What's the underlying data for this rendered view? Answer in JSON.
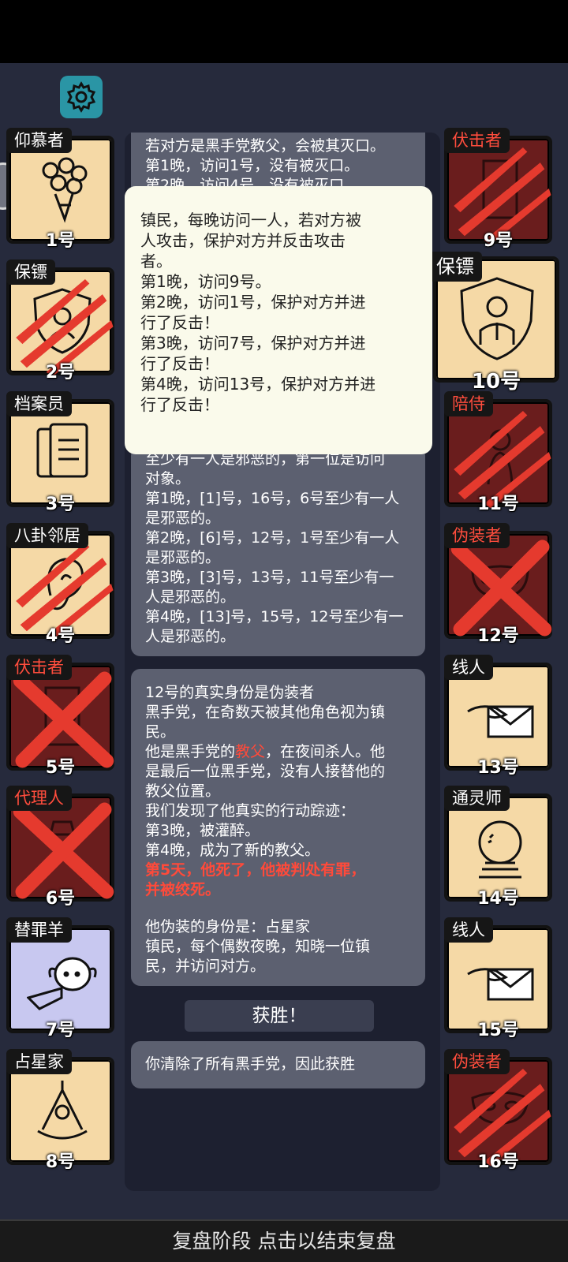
{
  "header": {
    "settings_icon": "gear-icon"
  },
  "players": [
    {
      "role": "仰慕者",
      "number": "1号",
      "state": "alive",
      "icon": "bouquet-icon",
      "role_red": false
    },
    {
      "role": "保镖",
      "number": "2号",
      "state": "alive",
      "icon": "shield-icon",
      "role_red": false,
      "clawed": true
    },
    {
      "role": "档案员",
      "number": "3号",
      "state": "alive",
      "icon": "documents-icon",
      "role_red": false
    },
    {
      "role": "八卦邻居",
      "number": "4号",
      "state": "alive",
      "icon": "ear-icon",
      "role_red": false,
      "clawed": true
    },
    {
      "role": "伏击者",
      "number": "5号",
      "state": "dead",
      "icon": "door-icon",
      "role_red": true,
      "crossed": true
    },
    {
      "role": "代理人",
      "number": "6号",
      "state": "dead",
      "icon": "agent-icon",
      "role_red": true,
      "crossed": true
    },
    {
      "role": "替罪羊",
      "number": "7号",
      "state": "goat",
      "icon": "scapegoat-icon",
      "role_red": false
    },
    {
      "role": "占星家",
      "number": "8号",
      "state": "alive",
      "icon": "sextant-icon",
      "role_red": false
    },
    {
      "role": "伏击者",
      "number": "9号",
      "state": "dead",
      "icon": "door-icon",
      "role_red": true,
      "clawed": true
    },
    {
      "role": "保镖",
      "number": "10号",
      "state": "alive",
      "icon": "bodyguard-shield-icon",
      "role_red": false,
      "selected": true
    },
    {
      "role": "陪侍",
      "number": "11号",
      "state": "dead",
      "icon": "escort-icon",
      "role_red": true,
      "clawed": true
    },
    {
      "role": "伪装者",
      "number": "12号",
      "state": "dead",
      "icon": "mask-icon",
      "role_red": true,
      "crossed": true
    },
    {
      "role": "线人",
      "number": "13号",
      "state": "alive",
      "icon": "envelope-hand-icon",
      "role_red": false
    },
    {
      "role": "通灵师",
      "number": "14号",
      "state": "alive",
      "icon": "crystal-ball-icon",
      "role_red": false
    },
    {
      "role": "线人",
      "number": "15号",
      "state": "alive",
      "icon": "envelope-hand-icon",
      "role_red": false
    },
    {
      "role": "伪装者",
      "number": "16号",
      "state": "dead",
      "icon": "mask-icon",
      "role_red": true,
      "clawed": true
    }
  ],
  "log": {
    "card1_lines": [
      "若对方是黑手党教父，会被其灭口。",
      "第1晚，访问1号，没有被灭口。",
      "第2晚，访问4号，没有被灭口。"
    ],
    "card2_lines": [
      "至少有一人是邪恶的，第一位是访问",
      "对象。",
      "第1晚，[1]号，16号，6号至少有一人",
      "是邪恶的。",
      "第2晚，[6]号，12号，1号至少有一人",
      "是邪恶的。",
      "第3晚，[3]号，13号，11号至少有一",
      "人是邪恶的。",
      "第4晚，[13]号，15号，12号至少有一",
      "人是邪恶的。"
    ],
    "card3": {
      "line1": "12号的真实身份是伪装者",
      "line2": "黑手党，在奇数天被其他角色视为镇",
      "line3": "民。",
      "line4_pre": "他是黑手党的",
      "line4_hl": "教父",
      "line4_post": "，在夜间杀人。他",
      "line5": "是最后一位黑手党，没有人接替他的",
      "line6": "教父位置。",
      "line7": "我们发现了他真实的行动踪迹：",
      "line8": "第3晚，被灌醉。",
      "line9": "第4晚，成为了新的教父。",
      "line10": "第5天，他死了，他被判处有罪，",
      "line11": "并被绞死。",
      "line12": "他伪装的身份是：占星家",
      "line13": "镇民，每个偶数夜晚，知晓一位镇",
      "line14": "民，并访问对方。"
    },
    "win_button": "获胜！",
    "result_text": "你清除了所有黑手党，因此获胜"
  },
  "popup_lines": [
    "镇民，每晚访问一人，若对方被",
    "人攻击，保护对方并反击攻击",
    "者。",
    "第1晚，访问9号。",
    "第2晚，访问1号，保护对方并进",
    "行了反击！",
    "第3晚，访问7号，保护对方并进",
    "行了反击！",
    "第4晚，访问13号，保护对方并进",
    "行了反击！"
  ],
  "footer": {
    "label": "复盘阶段 点击以结束复盘"
  },
  "colors": {
    "background": "#262a3c",
    "alive_tile": "#f5d9a6",
    "dead_tile": "#6a1d1d",
    "scapegoat_tile": "#c8c8f0",
    "danger": "#ff4a3a",
    "gear": "#2a95a5"
  }
}
